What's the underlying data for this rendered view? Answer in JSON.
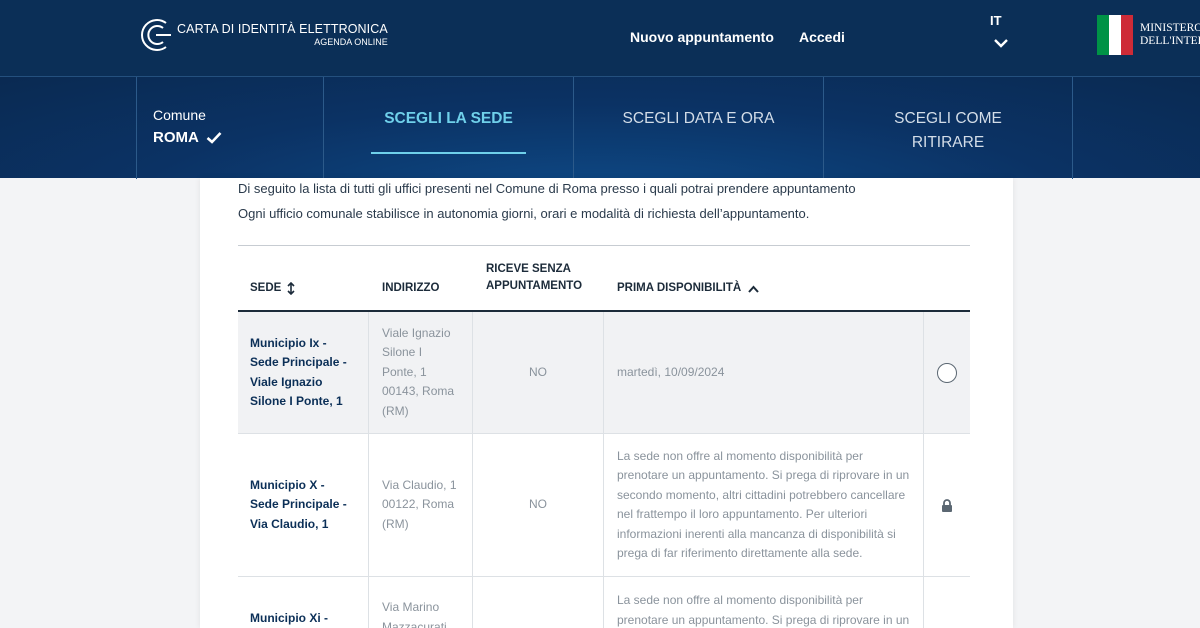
{
  "header": {
    "brand_title": "CARTA DI IDENTITÀ ELETTRONICA",
    "brand_subtitle": "AGENDA ONLINE",
    "nav": [
      {
        "label": "Nuovo appuntamento"
      },
      {
        "label": "Accedi"
      }
    ],
    "language": "IT",
    "ministry_line1": "MINISTERO",
    "ministry_line2": "DELL'INTERNO",
    "colors": {
      "primary": "#0b2f57",
      "accent": "#6fd0ea",
      "flag_green": "#009246",
      "flag_red": "#ce2b37"
    }
  },
  "steps": {
    "comune_label": "Comune",
    "comune_value": "ROMA",
    "items": [
      {
        "label": "SCEGLI LA SEDE",
        "active": true
      },
      {
        "label": "SCEGLI DATA E ORA",
        "active": false
      },
      {
        "label": "SCEGLI COME RITIRARE",
        "active": false
      }
    ]
  },
  "intro": {
    "line1": "Di seguito la lista di tutti gli uffici presenti nel Comune di Roma presso i quali potrai prendere appuntamento",
    "line2": "Ogni ufficio comunale stabilisce in autonomia giorni, orari e modalità di richiesta dell’appuntamento."
  },
  "table": {
    "headers": {
      "sede": "SEDE",
      "indirizzo": "INDIRIZZO",
      "riceve": "RICEVE SENZA APPUNTAMENTO",
      "prima": "PRIMA DISPONIBILITÀ"
    },
    "rows": [
      {
        "sede": "Municipio Ix - Sede Principale - Viale Ignazio Silone I Ponte, 1",
        "indirizzo": "Viale Ignazio Silone I Ponte, 1 00143, Roma (RM)",
        "senza_appuntamento": "NO",
        "prima_disponibilita": "martedì, 10/09/2024",
        "action": "radio"
      },
      {
        "sede": "Municipio X - Sede Principale - Via Claudio, 1",
        "indirizzo": "Via Claudio, 1 00122, Roma (RM)",
        "senza_appuntamento": "NO",
        "prima_disponibilita": "La sede non offre al momento disponibilità per prenotare un appuntamento. Si prega di riprovare in un secondo momento, altri cittadini potrebbero cancellare nel frattempo il loro appuntamento. Per ulteriori informazioni inerenti alla mancanza di disponibilità si prega di far riferimento direttamente alla sede.",
        "action": "lock"
      },
      {
        "sede": "Municipio Xi -",
        "indirizzo": "Via Marino Mazzacurati",
        "senza_appuntamento": "",
        "prima_disponibilita": "La sede non offre al momento disponibilità per prenotare un appuntamento. Si prega di riprovare in un",
        "action": ""
      }
    ]
  }
}
